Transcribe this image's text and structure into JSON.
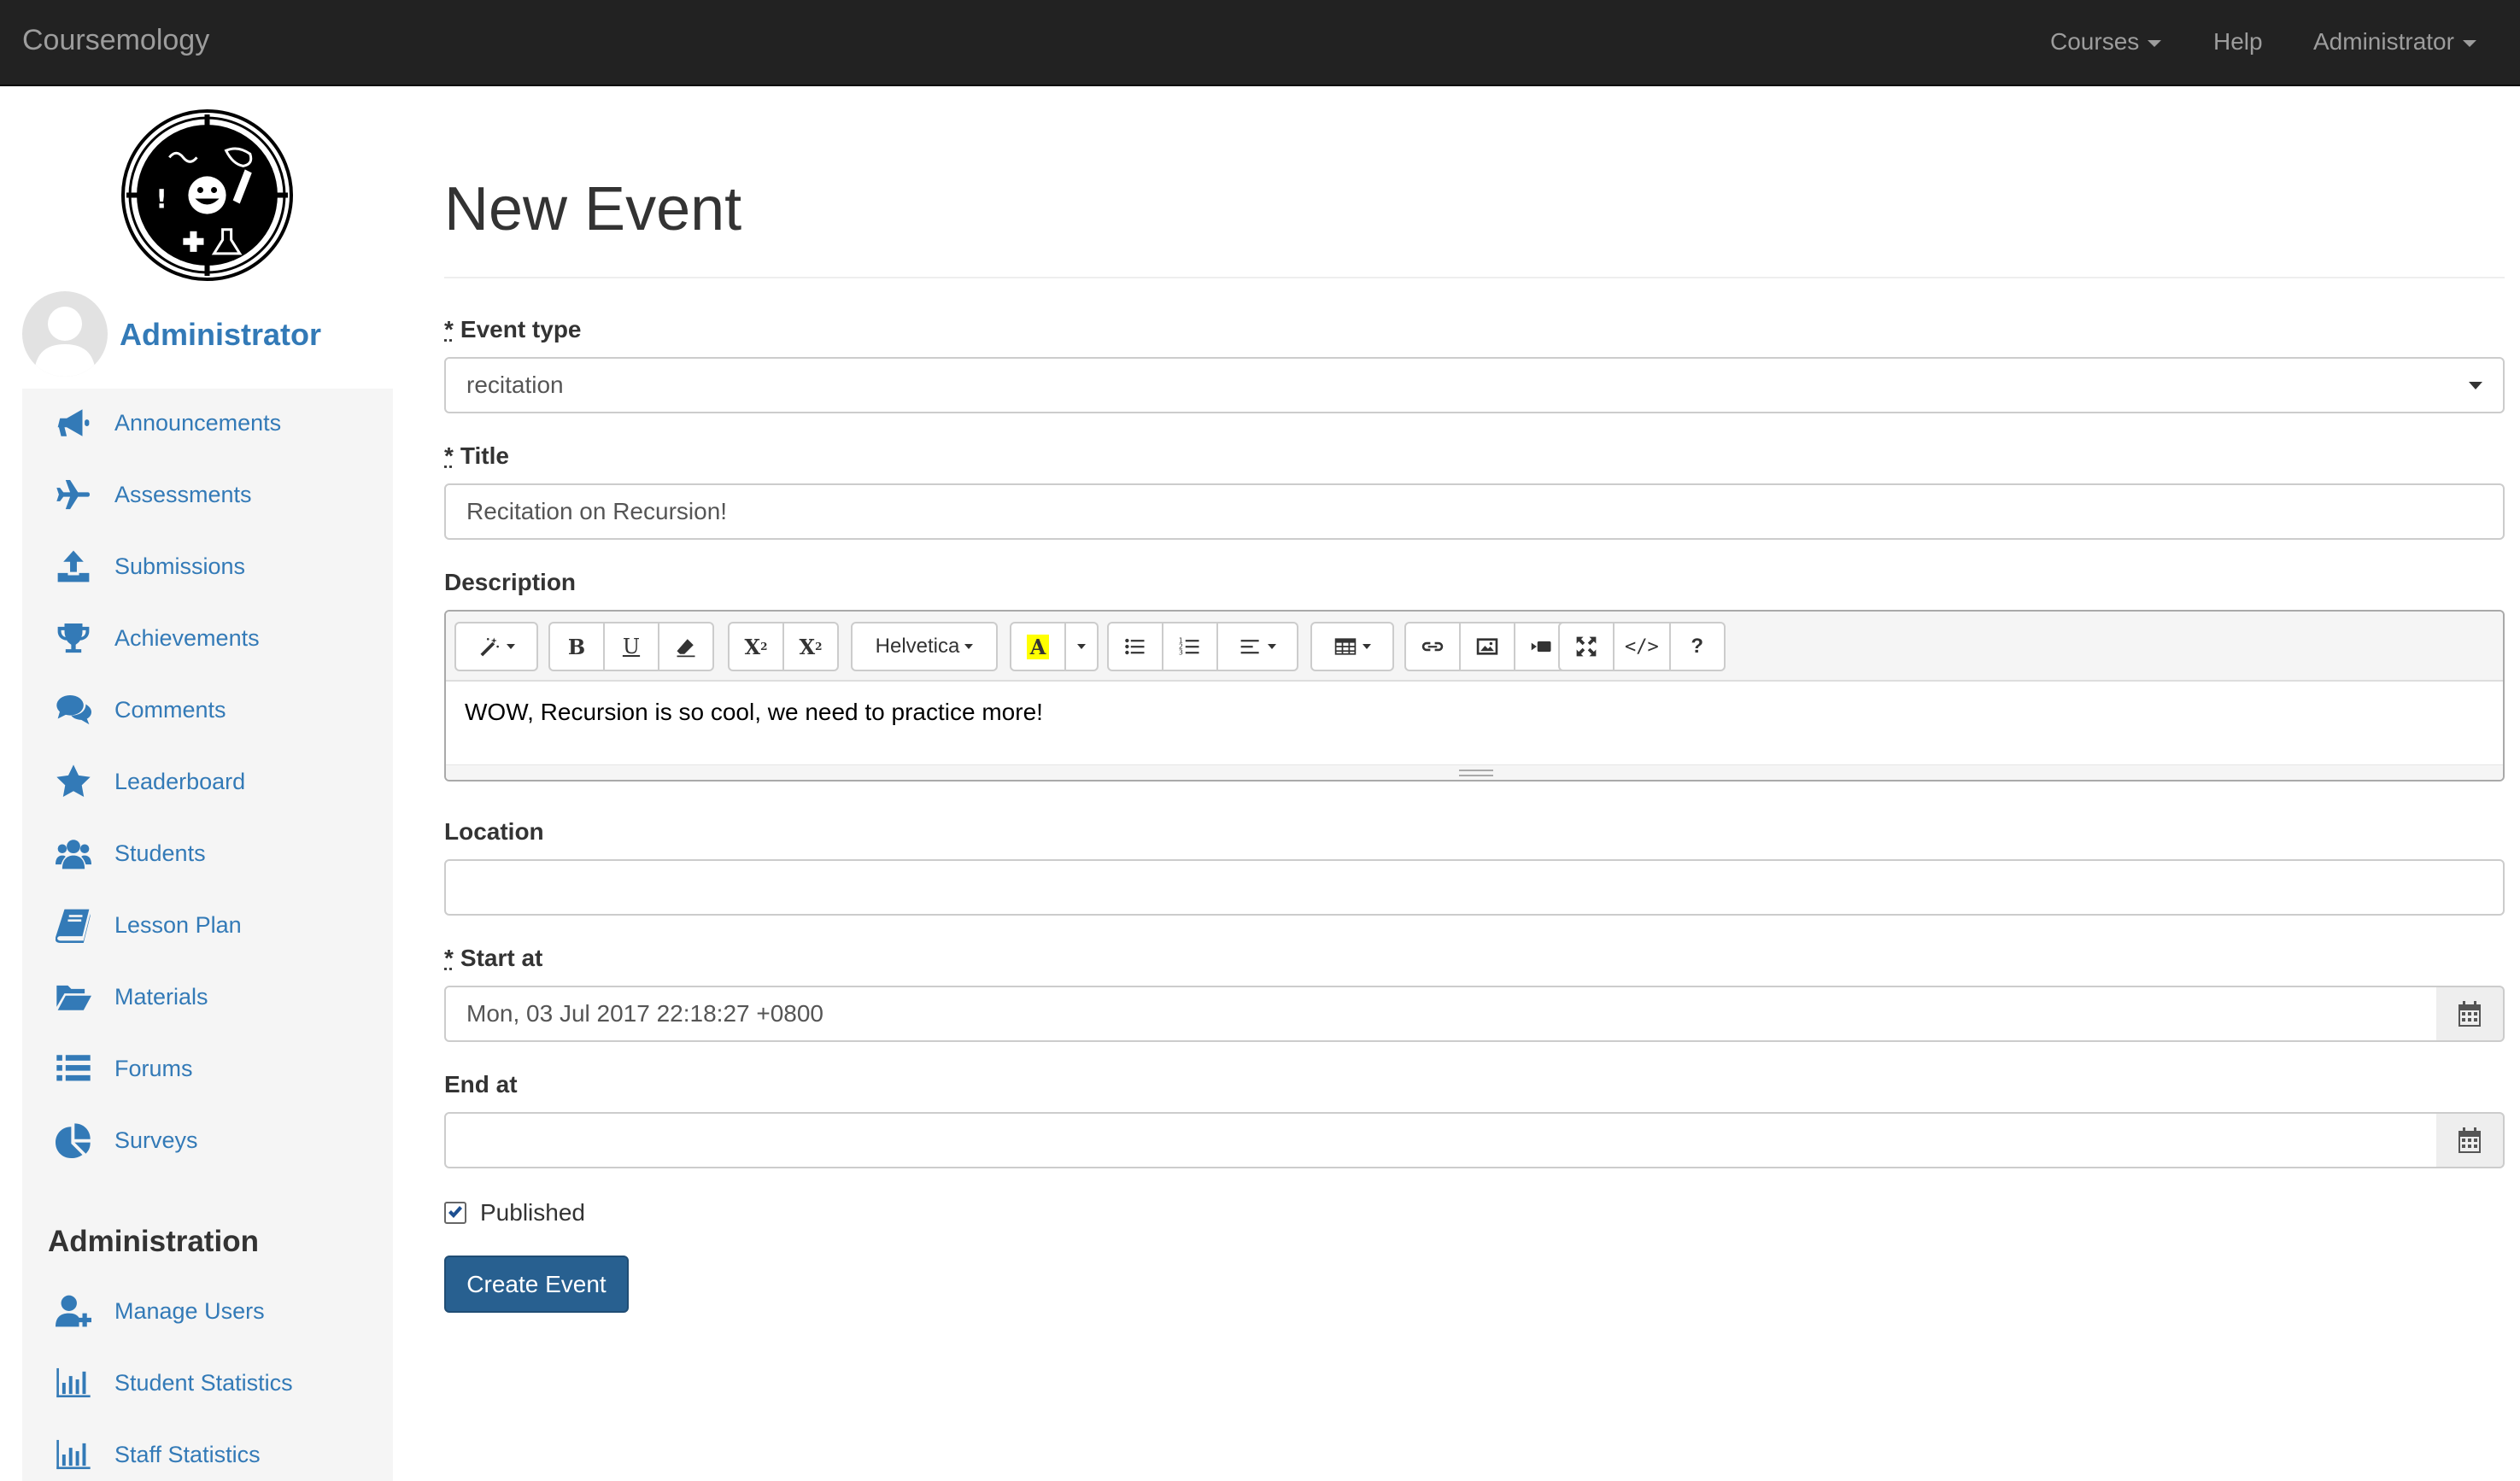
{
  "navbar": {
    "brand": "Coursemology",
    "links": [
      {
        "label": "Courses",
        "dropdown": true
      },
      {
        "label": "Help",
        "dropdown": false
      },
      {
        "label": "Administrator",
        "dropdown": true
      }
    ]
  },
  "sidebar": {
    "user_name": "Administrator",
    "items": [
      {
        "label": "Announcements",
        "icon": "bullhorn-icon"
      },
      {
        "label": "Assessments",
        "icon": "plane-icon"
      },
      {
        "label": "Submissions",
        "icon": "upload-icon"
      },
      {
        "label": "Achievements",
        "icon": "trophy-icon"
      },
      {
        "label": "Comments",
        "icon": "comments-icon"
      },
      {
        "label": "Leaderboard",
        "icon": "star-icon"
      },
      {
        "label": "Students",
        "icon": "users-icon"
      },
      {
        "label": "Lesson Plan",
        "icon": "book-icon"
      },
      {
        "label": "Materials",
        "icon": "folder-open-icon"
      },
      {
        "label": "Forums",
        "icon": "list-icon"
      },
      {
        "label": "Surveys",
        "icon": "pie-chart-icon"
      }
    ],
    "admin_heading": "Administration",
    "admin_items": [
      {
        "label": "Manage Users",
        "icon": "user-plus-icon"
      },
      {
        "label": "Student Statistics",
        "icon": "bar-chart-icon"
      },
      {
        "label": "Staff Statistics",
        "icon": "bar-chart-icon"
      }
    ]
  },
  "page": {
    "title": "New Event"
  },
  "form": {
    "required_marker": "*",
    "event_type": {
      "label": "Event type",
      "value": "recitation"
    },
    "title": {
      "label": "Title",
      "value": "Recitation on Recursion!"
    },
    "description": {
      "label": "Description",
      "value": "WOW, Recursion is so cool, we need to practice more!",
      "toolbar": {
        "bold": "B",
        "underline": "U",
        "superscript": "X",
        "subscript": "X",
        "font_name": "Helvetica",
        "color": "A",
        "codeview": "</>",
        "help": "?"
      }
    },
    "location": {
      "label": "Location",
      "value": ""
    },
    "start_at": {
      "label": "Start at",
      "value": "Mon, 03 Jul 2017 22:18:27 +0800"
    },
    "end_at": {
      "label": "End at",
      "value": ""
    },
    "published": {
      "label": "Published",
      "checked": true
    },
    "submit_label": "Create Event"
  },
  "colors": {
    "navbar_bg": "#222222",
    "link": "#337ab7",
    "primary_button": "#286090",
    "highlight_yellow": "#ffff00"
  }
}
